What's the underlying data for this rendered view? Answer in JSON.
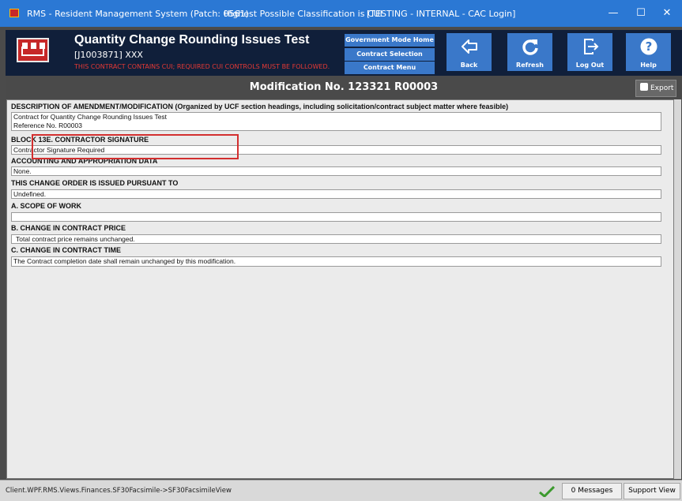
{
  "titlebar": {
    "app_title": "RMS - Resident Management System (Patch: 0561)",
    "classification": "Highest Possible Classification is CUI",
    "login": "[TESTING - INTERNAL - CAC Login]",
    "minimize": "—",
    "maximize": "☐",
    "close": "✕"
  },
  "header": {
    "title": "Quantity Change Rounding Issues Test",
    "contract_id": "[J1003871] XXX",
    "cui_notice": "THIS CONTRACT CONTAINS CUI; REQUIRED CUI CONTROLS MUST BE FOLLOWED.",
    "nav": {
      "home": "Government Mode Home",
      "selection": "Contract Selection",
      "menu": "Contract Menu"
    },
    "tools": {
      "back": "Back",
      "refresh": "Refresh",
      "logout": "Log Out",
      "help": "Help"
    }
  },
  "modbar": {
    "title": "Modification No. 123321 R00003",
    "export": "Export"
  },
  "sections": {
    "description": {
      "heading": "DESCRIPTION OF AMENDMENT/MODIFICATION (Organized by UCF section headings, including solicitation/contract subject matter where feasible)",
      "line1": "Contract for Quantity Change Rounding Issues Test",
      "line2": "Reference No. R00003"
    },
    "block13e": {
      "heading": "BLOCK 13E. CONTRACTOR SIGNATURE",
      "value": "Contractor Signature Required"
    },
    "accounting": {
      "heading": "ACCOUNTING AND APPROPRIATION DATA",
      "value": "None."
    },
    "pursuant": {
      "heading": "THIS CHANGE ORDER IS ISSUED PURSUANT TO",
      "value": "Undefined."
    },
    "scope": {
      "heading": "A. SCOPE OF WORK",
      "value": ""
    },
    "price": {
      "heading": "B. CHANGE IN CONTRACT PRICE",
      "value": "Total contract price remains unchanged."
    },
    "time": {
      "heading": "C. CHANGE IN CONTRACT TIME",
      "value": "The Contract completion date shall remain unchanged by this modification."
    }
  },
  "status": {
    "path": "Client.WPF.RMS.Views.Finances.SF30Facsimile->SF30FacsimileView",
    "messages": "0 Messages",
    "support": "Support View"
  },
  "colors": {
    "titlebar": "#2b78d4",
    "header": "#101f3a",
    "button": "#3a78c9",
    "cui_red": "#e53935",
    "highlight": "#d32f2f"
  }
}
